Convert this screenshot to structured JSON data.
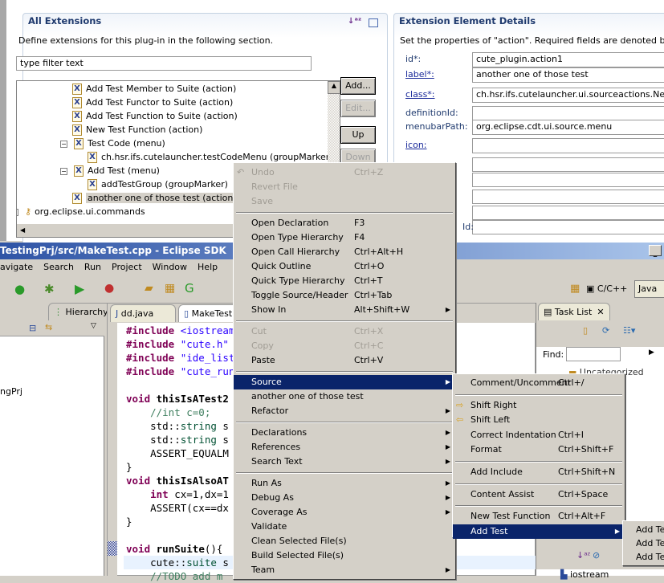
{
  "pde": {
    "all_ext": {
      "title": "All Extensions",
      "desc": "Define extensions for this plug-in in the following section.",
      "filter_placeholder": "type filter text",
      "tree": [
        {
          "label": "Add Test Member to Suite (action)",
          "lvl": 1
        },
        {
          "label": "Add Test Functor to Suite (action)",
          "lvl": 1
        },
        {
          "label": "Add Test Function to Suite (action)",
          "lvl": 1
        },
        {
          "label": "New Test Function (action)",
          "lvl": 1
        },
        {
          "label": "Test Code (menu)",
          "lvl": 1,
          "exp": "−"
        },
        {
          "label": "ch.hsr.ifs.cutelauncher.testCodeMenu (groupMarker)",
          "lvl": 2
        },
        {
          "label": "Add Test (menu)",
          "lvl": 1,
          "exp": "−"
        },
        {
          "label": "addTestGroup (groupMarker)",
          "lvl": 2
        },
        {
          "label": "another one of those test (action)",
          "lvl": 1,
          "sel": true
        },
        {
          "label": "org.eclipse.ui.commands",
          "lvl": 0,
          "exp": "+"
        }
      ],
      "buttons": {
        "add": "Add...",
        "edit": "Edit...",
        "up": "Up",
        "down": "Down"
      }
    },
    "details": {
      "title": "Extension Element Details",
      "desc": "Set the properties of \"action\". Required fields are denoted by \"*\".",
      "fields": [
        {
          "label": "id*:",
          "value": "cute_plugin.action1",
          "link": false
        },
        {
          "label": "label*:",
          "value": "another one of those test",
          "link": true
        },
        {
          "label": "class*:",
          "value": "ch.hsr.ifs.cutelauncher.ui.sourceactions.NewTestFunction",
          "link": true
        },
        {
          "label": "definitionId:",
          "value": "",
          "link": false
        },
        {
          "label": "menubarPath:",
          "value": "org.eclipse.cdt.ui.source.menu",
          "link": false
        },
        {
          "label": "icon:",
          "value": "",
          "link": true
        }
      ],
      "partial_label": "Id:"
    }
  },
  "window": {
    "title": "TestingPrj/src/MakeTest.cpp - Eclipse SDK",
    "menubar": [
      "avigate",
      "Search",
      "Run",
      "Project",
      "Window",
      "Help"
    ],
    "perspectives": {
      "cpp": "C/C++",
      "java": "Java"
    }
  },
  "left_view": {
    "tab": "Hierarchy",
    "tree_item": "ngPrj"
  },
  "editor": {
    "tabs": [
      "dd.java",
      "MakeTest.cpp"
    ],
    "lines": [
      [
        [
          "#include ",
          "kw"
        ],
        [
          "<iostream>",
          "str"
        ]
      ],
      [
        [
          "#include ",
          "kw"
        ],
        [
          "\"cute.h\"",
          "str"
        ]
      ],
      [
        [
          "#include ",
          "kw"
        ],
        [
          "\"ide_listener.h\"",
          "str"
        ]
      ],
      [
        [
          "#include ",
          "kw"
        ],
        [
          "\"cute_runner.h\"",
          "str"
        ]
      ],
      [],
      [
        [
          "void ",
          "kw"
        ],
        [
          "thisIsATest2",
          "b"
        ]
      ],
      [
        [
          "    //int c=0;",
          "cm"
        ]
      ],
      [
        [
          "    std::",
          ""
        ],
        [
          "string",
          "ty"
        ],
        [
          " s",
          ""
        ]
      ],
      [
        [
          "    std::",
          ""
        ],
        [
          "string",
          "ty"
        ],
        [
          " s",
          ""
        ]
      ],
      [
        [
          "    ASSERT_EQUALM",
          ""
        ]
      ],
      [
        [
          "}",
          ""
        ]
      ],
      [
        [
          "void ",
          "kw"
        ],
        [
          "thisIsAlsoAT",
          "b"
        ]
      ],
      [
        [
          "    ",
          ""
        ],
        [
          "int ",
          "kw"
        ],
        [
          "cx=1,dx=1",
          ""
        ]
      ],
      [
        [
          "    ASSERT(cx==dx",
          ""
        ]
      ],
      [
        [
          "}",
          ""
        ]
      ],
      [],
      [
        [
          "void ",
          "kw"
        ],
        [
          "runSuite",
          "b"
        ],
        [
          "(){",
          ""
        ]
      ],
      [
        [
          "    cute::",
          ""
        ],
        [
          "suite",
          "ty"
        ],
        [
          " s",
          ""
        ]
      ],
      [
        [
          "    //TODO add m",
          "cm"
        ]
      ]
    ]
  },
  "task_list": {
    "tab": "Task List",
    "find_label": "Find:",
    "category": "Uncategorized",
    "outline_item": "iostream"
  },
  "context_menu": [
    {
      "label": "Undo",
      "shortcut": "Ctrl+Z",
      "disabled": true,
      "icon": "undo-icon"
    },
    {
      "label": "Revert File",
      "disabled": true
    },
    {
      "label": "Save",
      "disabled": true
    },
    {
      "sep": true
    },
    {
      "label": "Open Declaration",
      "shortcut": "F3"
    },
    {
      "label": "Open Type Hierarchy",
      "shortcut": "F4"
    },
    {
      "label": "Open Call Hierarchy",
      "shortcut": "Ctrl+Alt+H"
    },
    {
      "label": "Quick Outline",
      "shortcut": "Ctrl+O"
    },
    {
      "label": "Quick Type Hierarchy",
      "shortcut": "Ctrl+T"
    },
    {
      "label": "Toggle Source/Header",
      "shortcut": "Ctrl+Tab"
    },
    {
      "label": "Show In",
      "shortcut": "Alt+Shift+W",
      "sub": true
    },
    {
      "sep": true
    },
    {
      "label": "Cut",
      "shortcut": "Ctrl+X",
      "disabled": true
    },
    {
      "label": "Copy",
      "shortcut": "Ctrl+C",
      "disabled": true
    },
    {
      "label": "Paste",
      "shortcut": "Ctrl+V"
    },
    {
      "sep": true
    },
    {
      "label": "Source",
      "sub": true,
      "hl": true
    },
    {
      "label": "another one of those test"
    },
    {
      "label": "Refactor",
      "sub": true
    },
    {
      "sep": true
    },
    {
      "label": "Declarations",
      "sub": true
    },
    {
      "label": "References",
      "sub": true
    },
    {
      "label": "Search Text",
      "sub": true
    },
    {
      "sep": true
    },
    {
      "label": "Run As",
      "sub": true
    },
    {
      "label": "Debug As",
      "sub": true
    },
    {
      "label": "Coverage As",
      "sub": true
    },
    {
      "label": "Validate"
    },
    {
      "label": "Clean Selected File(s)"
    },
    {
      "label": "Build Selected File(s)"
    },
    {
      "label": "Team",
      "sub": true
    }
  ],
  "source_menu": [
    {
      "label": "Comment/Uncomment",
      "shortcut": "Ctrl+/"
    },
    {
      "sep": true
    },
    {
      "label": "Shift Right",
      "icon": "shift-right-icon"
    },
    {
      "label": "Shift Left",
      "icon": "shift-left-icon"
    },
    {
      "label": "Correct Indentation",
      "shortcut": "Ctrl+I"
    },
    {
      "label": "Format",
      "shortcut": "Ctrl+Shift+F"
    },
    {
      "sep": true
    },
    {
      "label": "Add Include",
      "shortcut": "Ctrl+Shift+N"
    },
    {
      "sep": true
    },
    {
      "label": "Content Assist",
      "shortcut": "Ctrl+Space"
    },
    {
      "sep": true
    },
    {
      "label": "New Test Function",
      "shortcut": "Ctrl+Alt+F"
    },
    {
      "label": "Add Test",
      "sub": true,
      "hl": true
    }
  ],
  "add_test_menu": [
    {
      "label": "Add Te"
    },
    {
      "label": "Add Te"
    },
    {
      "label": "Add Te"
    }
  ],
  "colors": {
    "menu_highlight": "#0a246a",
    "keyword": "#7f0055",
    "string": "#2a00ff",
    "comment": "#3f7f5f"
  }
}
